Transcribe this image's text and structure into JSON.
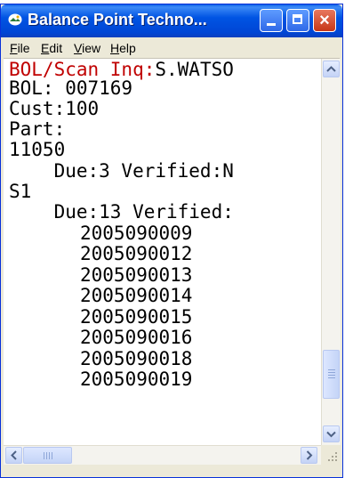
{
  "window": {
    "title": "Balance Point Techno...",
    "controls": {
      "minimize": "minimize",
      "maximize": "maximize",
      "close": "×"
    }
  },
  "menu": [
    {
      "label_ul": "F",
      "label_rest": "ile"
    },
    {
      "label_ul": "E",
      "label_rest": "dit"
    },
    {
      "label_ul": "V",
      "label_rest": "iew"
    },
    {
      "label_ul": "H",
      "label_rest": "elp"
    }
  ],
  "screen": {
    "header_label": "BOL/Scan Inq:",
    "header_user": "S.WATSO",
    "bol": "BOL: 007169",
    "cust": "Cust:100",
    "part_label": "Part:",
    "part_number": "11050",
    "due_line_1": "    Due:3 Verified:N",
    "sub_part": "S1",
    "due_line_2": "    Due:13 Verified:",
    "serials": [
      "2005090009",
      "2005090012",
      "2005090013",
      "2005090014",
      "2005090015",
      "2005090016",
      "2005090018",
      "2005090019"
    ]
  },
  "colors": {
    "title_bar": "#0054e3",
    "header_red": "#c00000"
  }
}
